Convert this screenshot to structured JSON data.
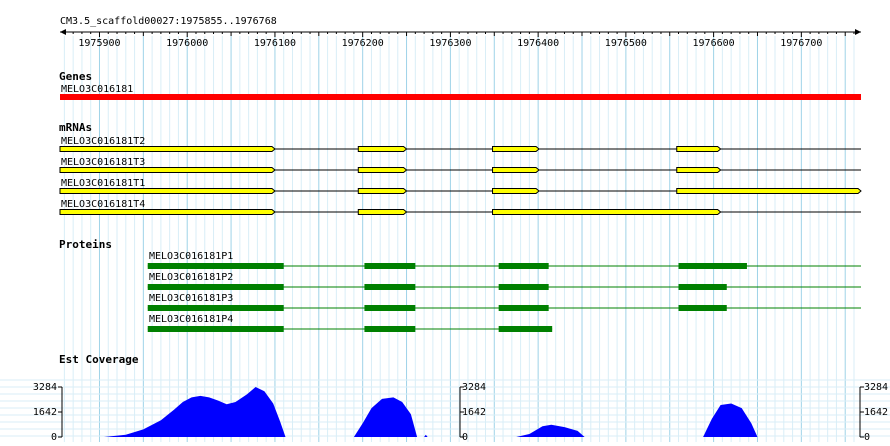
{
  "region": {
    "label": "CM3.5_scaffold00027:1975855..1976768",
    "start": 1975855,
    "end": 1976768,
    "ticks": [
      "1975900",
      "1976000",
      "1976100",
      "1976200",
      "1976300",
      "1976400",
      "1976500",
      "1976600",
      "1976700"
    ]
  },
  "colors": {
    "grid_major": "#9fd3e8",
    "grid_minor": "#d9eef7",
    "gene": "#ff0000",
    "mrna": "#ffff00",
    "protein": "#008000",
    "coverage": "#0000ff"
  },
  "tracks": {
    "genes": {
      "title": "Genes",
      "items": [
        {
          "name": "MELO3C016181",
          "start": 1975855,
          "end": 1976768
        }
      ]
    },
    "mrnas": {
      "title": "mRNAs",
      "items": [
        {
          "name": "MELO3C016181T2",
          "start": 1975855,
          "end": 1976768,
          "exons": [
            [
              1975855,
              1976100
            ],
            [
              1976195,
              1976250
            ],
            [
              1976348,
              1976401
            ],
            [
              1976558,
              1976608
            ]
          ]
        },
        {
          "name": "MELO3C016181T3",
          "start": 1975855,
          "end": 1976768,
          "exons": [
            [
              1975855,
              1976100
            ],
            [
              1976195,
              1976250
            ],
            [
              1976348,
              1976401
            ],
            [
              1976558,
              1976608
            ]
          ]
        },
        {
          "name": "MELO3C016181T1",
          "start": 1975855,
          "end": 1976768,
          "exons": [
            [
              1975855,
              1976100
            ],
            [
              1976195,
              1976250
            ],
            [
              1976348,
              1976401
            ],
            [
              1976558,
              1976768
            ]
          ]
        },
        {
          "name": "MELO3C016181T4",
          "start": 1975855,
          "end": 1976768,
          "exons": [
            [
              1975855,
              1976100
            ],
            [
              1976195,
              1976250
            ],
            [
              1976348,
              1976608
            ]
          ]
        }
      ]
    },
    "proteins": {
      "title": "Proteins",
      "items": [
        {
          "name": "MELO3C016181P1",
          "start": 1975955,
          "end": 1976768,
          "exons": [
            [
              1975955,
              1976110
            ],
            [
              1976202,
              1976260
            ],
            [
              1976355,
              1976412
            ],
            [
              1976560,
              1976638
            ]
          ]
        },
        {
          "name": "MELO3C016181P2",
          "start": 1975955,
          "end": 1976768,
          "exons": [
            [
              1975955,
              1976110
            ],
            [
              1976202,
              1976260
            ],
            [
              1976355,
              1976412
            ],
            [
              1976560,
              1976615
            ]
          ]
        },
        {
          "name": "MELO3C016181P3",
          "start": 1975955,
          "end": 1976768,
          "exons": [
            [
              1975955,
              1976110
            ],
            [
              1976202,
              1976260
            ],
            [
              1976355,
              1976412
            ],
            [
              1976560,
              1976615
            ]
          ]
        },
        {
          "name": "MELO3C016181P4",
          "start": 1975955,
          "end": 1976416,
          "exons": [
            [
              1975955,
              1976110
            ],
            [
              1976202,
              1976260
            ],
            [
              1976355,
              1976416
            ]
          ]
        }
      ]
    },
    "coverage": {
      "title": "Est Coverage",
      "max_label": "3284",
      "mid_label": "1642",
      "zero_label": "0",
      "max": 3284,
      "profile": [
        [
          1975905,
          0
        ],
        [
          1975930,
          150
        ],
        [
          1975950,
          500
        ],
        [
          1975970,
          1100
        ],
        [
          1975985,
          1800
        ],
        [
          1975995,
          2300
        ],
        [
          1976005,
          2600
        ],
        [
          1976015,
          2700
        ],
        [
          1976025,
          2600
        ],
        [
          1976035,
          2400
        ],
        [
          1976045,
          2150
        ],
        [
          1976055,
          2300
        ],
        [
          1976068,
          2800
        ],
        [
          1976078,
          3284
        ],
        [
          1976088,
          3000
        ],
        [
          1976098,
          2200
        ],
        [
          1976106,
          1000
        ],
        [
          1976112,
          0
        ],
        [
          1976190,
          0
        ],
        [
          1976200,
          900
        ],
        [
          1976210,
          1900
        ],
        [
          1976222,
          2500
        ],
        [
          1976235,
          2600
        ],
        [
          1976245,
          2300
        ],
        [
          1976255,
          1500
        ],
        [
          1976262,
          0
        ],
        [
          1976270,
          0
        ],
        [
          1976272,
          150
        ],
        [
          1976274,
          0
        ],
        [
          1976375,
          0
        ],
        [
          1976390,
          200
        ],
        [
          1976405,
          700
        ],
        [
          1976415,
          800
        ],
        [
          1976430,
          650
        ],
        [
          1976445,
          400
        ],
        [
          1976453,
          0
        ],
        [
          1976588,
          0
        ],
        [
          1976598,
          1200
        ],
        [
          1976608,
          2100
        ],
        [
          1976620,
          2200
        ],
        [
          1976632,
          1900
        ],
        [
          1976643,
          900
        ],
        [
          1976650,
          0
        ]
      ]
    }
  }
}
